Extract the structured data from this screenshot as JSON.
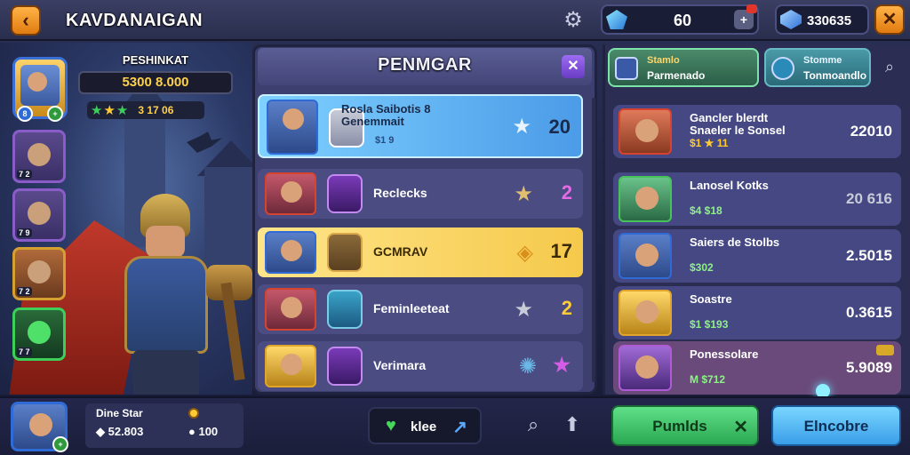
{
  "header": {
    "title": "KAVDANAIGAN",
    "currency_1": "60",
    "currency_2": "330635"
  },
  "hero": {
    "label": "PESHINKAT",
    "power": "5300 8.000",
    "stars_value": "3 17 06"
  },
  "hero_slots": [
    {
      "count": "7 2"
    },
    {
      "count": "7 9"
    },
    {
      "count": "7 2"
    },
    {
      "count": "7 7"
    }
  ],
  "panel": {
    "title": "PENMGAR",
    "rows": [
      {
        "name": "Rosla Saibotis 8\nGenemmait",
        "sub": "$1 9",
        "value": "20"
      },
      {
        "name": "Reclecks",
        "value": "2"
      },
      {
        "name": "GCMRAV",
        "value": "17"
      },
      {
        "name": "Feminleeteat",
        "value": "2"
      },
      {
        "name": "Verimara",
        "value": ""
      }
    ]
  },
  "right_tabs": [
    {
      "line1": "Stamlo",
      "line2": "Parmenado"
    },
    {
      "line1": "Stomme",
      "line2": "Tonmoandlo"
    }
  ],
  "leaderboard": [
    {
      "title": "Gancler blerdt\nSnaeler le Sonsel",
      "meta": "$1 ★ 11",
      "score": "22010"
    },
    {
      "title": "Lanosel Kotks",
      "meta": "$4 $18",
      "score": "20 616"
    },
    {
      "title": "Saiers de Stolbs",
      "meta": "$302",
      "score": "2.5015"
    },
    {
      "title": "Soastre",
      "meta": "$1 $193",
      "score": "0.3615"
    },
    {
      "title": "Ponessolare",
      "meta": "M $712",
      "score": "5.9089"
    }
  ],
  "bottom": {
    "player_name": "Dine Star",
    "stat_1": "52.803",
    "stat_2": "100",
    "like_label": "klee",
    "green_button": "Pumlds",
    "blue_button": "Elncobre"
  }
}
